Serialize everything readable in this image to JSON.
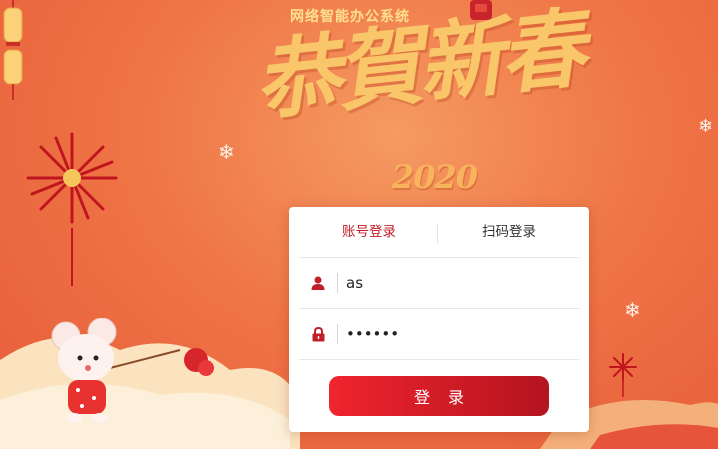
{
  "app": {
    "system_title": "网络智能办公系统"
  },
  "banner": {
    "headline": "恭賀新春",
    "year": "2020",
    "colors": {
      "background": "#ef7546",
      "headline": "#f9c76a",
      "accent": "#c0202a"
    }
  },
  "login": {
    "tabs": [
      {
        "label": "账号登录",
        "active": true
      },
      {
        "label": "扫码登录",
        "active": false
      }
    ],
    "username": {
      "value": "as",
      "icon": "user-icon"
    },
    "password": {
      "value": "aaaaaa",
      "icon": "lock-icon"
    },
    "submit_label": "登录"
  }
}
